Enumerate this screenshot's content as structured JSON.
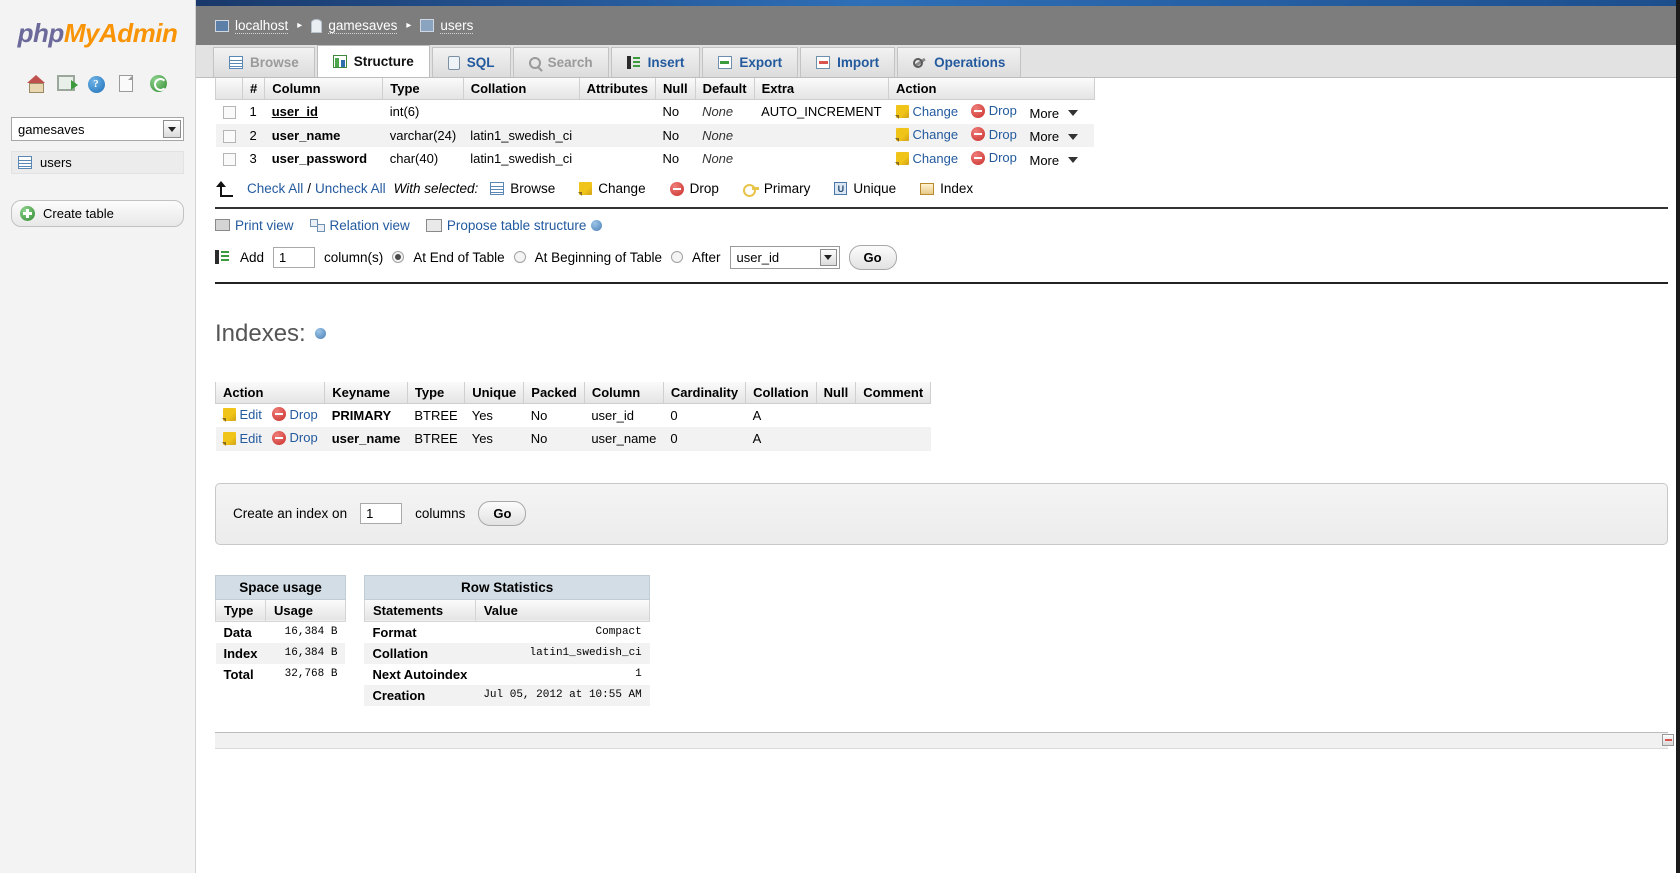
{
  "sidebar": {
    "logo_php": "php",
    "logo_mysql": "MyAdmin",
    "icons": [
      {
        "name": "home-icon",
        "label": "Home"
      },
      {
        "name": "logout-icon",
        "label": "Log out"
      },
      {
        "name": "help-icon",
        "label": "?"
      },
      {
        "name": "docs-icon",
        "label": "Documentation"
      },
      {
        "name": "reload-icon",
        "label": "Reload"
      }
    ],
    "database_select": {
      "value": "gamesaves"
    },
    "tables": [
      {
        "label": "users"
      }
    ],
    "create_table_label": "Create table"
  },
  "breadcrumb": {
    "server": "localhost",
    "database": "gamesaves",
    "table": "users",
    "separator": "▸"
  },
  "tabs": [
    {
      "label": "Browse",
      "icon": "browse-icon",
      "state": "disabled"
    },
    {
      "label": "Structure",
      "icon": "structure-icon",
      "state": "active"
    },
    {
      "label": "SQL",
      "icon": "sql-icon",
      "state": "normal"
    },
    {
      "label": "Search",
      "icon": "search-icon",
      "state": "disabled"
    },
    {
      "label": "Insert",
      "icon": "insert-icon",
      "state": "normal"
    },
    {
      "label": "Export",
      "icon": "export-icon",
      "state": "normal"
    },
    {
      "label": "Import",
      "icon": "import-icon",
      "state": "normal"
    },
    {
      "label": "Operations",
      "icon": "operations-icon",
      "state": "normal"
    }
  ],
  "structure": {
    "headers": [
      "",
      "#",
      "Column",
      "Type",
      "Collation",
      "Attributes",
      "Null",
      "Default",
      "Extra",
      "Action"
    ],
    "rows": [
      {
        "num": "1",
        "column": "user_id",
        "primary": true,
        "type": "int(6)",
        "collation": "",
        "attributes": "",
        "null": "No",
        "default": "None",
        "extra": "AUTO_INCREMENT",
        "change": "Change",
        "drop": "Drop",
        "more": "More"
      },
      {
        "num": "2",
        "column": "user_name",
        "primary": false,
        "type": "varchar(24)",
        "collation": "latin1_swedish_ci",
        "attributes": "",
        "null": "No",
        "default": "None",
        "extra": "",
        "change": "Change",
        "drop": "Drop",
        "more": "More"
      },
      {
        "num": "3",
        "column": "user_password",
        "primary": false,
        "type": "char(40)",
        "collation": "latin1_swedish_ci",
        "attributes": "",
        "null": "No",
        "default": "None",
        "extra": "",
        "change": "Change",
        "drop": "Drop",
        "more": "More"
      }
    ]
  },
  "selection_bar": {
    "check_all": "Check All",
    "slash": "/",
    "uncheck_all": "Uncheck All",
    "with_selected": "With selected:",
    "actions": [
      {
        "label": "Browse",
        "icon": "browse-icon"
      },
      {
        "label": "Change",
        "icon": "pencil-icon"
      },
      {
        "label": "Drop",
        "icon": "drop-icon"
      },
      {
        "label": "Primary",
        "icon": "key-icon"
      },
      {
        "label": "Unique",
        "icon": "unique-icon"
      },
      {
        "label": "Index",
        "icon": "index-icon"
      }
    ]
  },
  "views": [
    {
      "label": "Print view",
      "icon": "print-icon"
    },
    {
      "label": "Relation view",
      "icon": "relation-icon"
    },
    {
      "label": "Propose table structure",
      "icon": "propose-icon"
    }
  ],
  "add_columns": {
    "add_label": "Add",
    "count_value": "1",
    "columns_label": "column(s)",
    "at_end_label": "At End of Table",
    "at_beginning_label": "At Beginning of Table",
    "after_label": "After",
    "after_value": "user_id",
    "go_label": "Go",
    "selected_position": "at_end"
  },
  "indexes": {
    "title": "Indexes:",
    "headers": [
      "Action",
      "Keyname",
      "Type",
      "Unique",
      "Packed",
      "Column",
      "Cardinality",
      "Collation",
      "Null",
      "Comment"
    ],
    "rows": [
      {
        "edit": "Edit",
        "drop": "Drop",
        "keyname": "PRIMARY",
        "type": "BTREE",
        "unique": "Yes",
        "packed": "No",
        "column": "user_id",
        "cardinality": "0",
        "collation": "A",
        "null": "",
        "comment": ""
      },
      {
        "edit": "Edit",
        "drop": "Drop",
        "keyname": "user_name",
        "type": "BTREE",
        "unique": "Yes",
        "packed": "No",
        "column": "user_name",
        "cardinality": "0",
        "collation": "A",
        "null": "",
        "comment": ""
      }
    ]
  },
  "create_index": {
    "label": "Create an index on",
    "value": "1",
    "columns_label": "columns",
    "go_label": "Go"
  },
  "space_usage": {
    "caption": "Space usage",
    "headers": [
      "Type",
      "Usage"
    ],
    "rows": [
      {
        "type": "Data",
        "usage": "16,384",
        "unit": "B"
      },
      {
        "type": "Index",
        "usage": "16,384",
        "unit": "B"
      },
      {
        "type": "Total",
        "usage": "32,768",
        "unit": "B"
      }
    ]
  },
  "row_statistics": {
    "caption": "Row Statistics",
    "headers": [
      "Statements",
      "Value"
    ],
    "rows": [
      {
        "statement": "Format",
        "value": "Compact"
      },
      {
        "statement": "Collation",
        "value": "latin1_swedish_ci"
      },
      {
        "statement": "Next Autoindex",
        "value": "1"
      },
      {
        "statement": "Creation",
        "value": "Jul 05, 2012 at 10:55 AM"
      }
    ]
  },
  "colors": {
    "brand_orange": "#f89406",
    "brand_purple": "#6c6a9a",
    "link_blue": "#235a9e",
    "breadcrumb_bg": "#7d7d7d",
    "caption_bg": "#d3dde5"
  }
}
